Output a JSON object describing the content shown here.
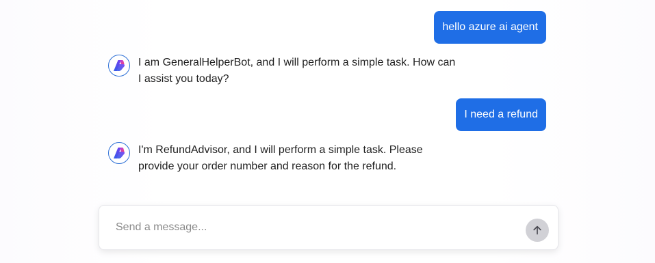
{
  "messages": [
    {
      "role": "user",
      "text": "hello azure ai agent"
    },
    {
      "role": "assistant",
      "text": "I am GeneralHelperBot, and I will perform a simple task. How can I assist you today?",
      "avatar_icon": "azure-ai-agent-logo-icon"
    },
    {
      "role": "user",
      "text": "I need a refund"
    },
    {
      "role": "assistant",
      "text": "I'm RefundAdvisor, and I will perform a simple task. Please provide your order number and reason for the refund.",
      "avatar_icon": "azure-ai-agent-logo-icon"
    }
  ],
  "composer": {
    "placeholder": "Send a message...",
    "value": "",
    "send_icon": "arrow-up-icon"
  },
  "colors": {
    "user_bubble": "#1f6ee6",
    "send_button": "#d1d1d6",
    "avatar_border": "#2c6fd6"
  }
}
